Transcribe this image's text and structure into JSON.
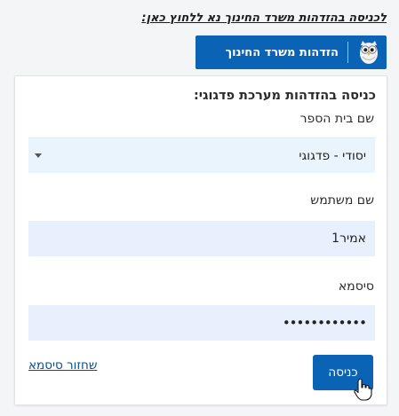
{
  "ministry": {
    "link_text": "לכניסה בהזדהות משרד החינוך נא ללחוץ כאן:",
    "button_label": "הזדהות משרד החינוך",
    "logo_icon": "owl-logo-icon"
  },
  "form": {
    "title": "כניסה בהזדהות מערכת פדגוגי:",
    "school": {
      "label": "שם בית הספר",
      "selected_value": "יסודי - פדגוגי"
    },
    "username": {
      "label": "שם משתמש",
      "value": "אמיר1"
    },
    "password": {
      "label": "סיסמא",
      "masked_value": "••••••••••••"
    },
    "reset_password_label": "שחזור סיסמא",
    "submit_label": "כניסה"
  },
  "colors": {
    "primary": "#0a63b4",
    "field_bg": "#e8f0fe"
  }
}
